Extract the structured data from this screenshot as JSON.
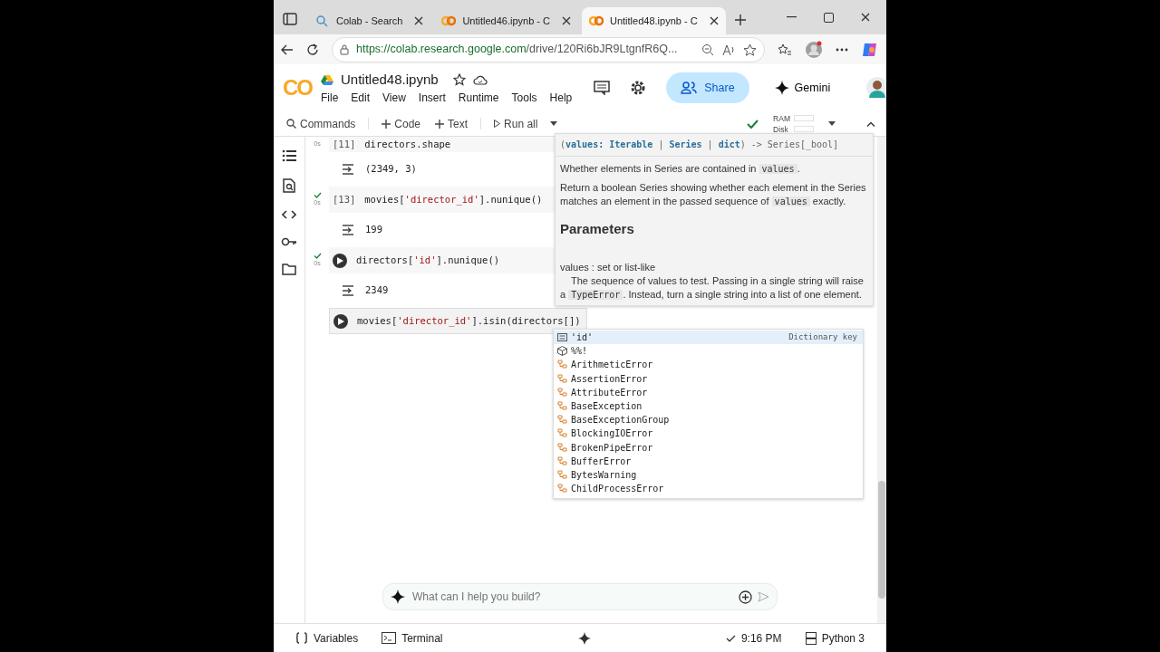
{
  "browser": {
    "tabs": [
      {
        "title": "Colab - Search",
        "selected": false
      },
      {
        "title": "Untitled46.ipynb - C",
        "selected": false
      },
      {
        "title": "Untitled48.ipynb - C",
        "selected": true
      }
    ],
    "url_host": "https://colab.research.google.com",
    "url_path": "/drive/120Ri6bJR9LtgnfR6Q..."
  },
  "notebook": {
    "title": "Untitled48.ipynb",
    "logo": "CO",
    "menu": [
      "File",
      "Edit",
      "View",
      "Insert",
      "Runtime",
      "Tools",
      "Help"
    ],
    "share": "Share",
    "gemini": "Gemini"
  },
  "toolbar": {
    "commands": "Commands",
    "code": "Code",
    "text": "Text",
    "run_all": "Run all",
    "ram": "RAM",
    "disk": "Disk",
    "connected": true
  },
  "cells": [
    {
      "prompt": "[11]",
      "code": "directors.shape",
      "time": "0s",
      "done": false,
      "run_button": false,
      "active": false,
      "output": "(2349, 3)"
    },
    {
      "prompt": "[13]",
      "code": "movies['director_id'].nunique()",
      "time": "0s",
      "done": true,
      "run_button": false,
      "active": false,
      "output": "199"
    },
    {
      "code": "directors['id'].nunique()",
      "time": "0s",
      "done": true,
      "run_button": true,
      "active": false,
      "output": "2349"
    },
    {
      "code": "movies['director_id'].isin(directors[])",
      "done": false,
      "run_button": true,
      "active": true
    }
  ],
  "tooltip": {
    "signature": [
      {
        "text": "(",
        "kind": "punct"
      },
      {
        "text": "values",
        "kind": "kw"
      },
      {
        "text": ": ",
        "kind": "kw"
      },
      {
        "text": "Iterable",
        "kind": "kw"
      },
      {
        "text": " | ",
        "kind": "punct"
      },
      {
        "text": "Series",
        "kind": "kw"
      },
      {
        "text": " | ",
        "kind": "punct"
      },
      {
        "text": "dict",
        "kind": "kw"
      },
      {
        "text": ") -> Series[_bool]",
        "kind": "punct"
      }
    ],
    "paragraphs": [
      [
        {
          "text": "Whether elements in Series are contained in ",
          "kind": "text"
        },
        {
          "text": "values",
          "kind": "code"
        },
        {
          "text": ".",
          "kind": "text"
        }
      ],
      [
        {
          "text": "Return a boolean Series showing whether each element in the Series matches an element in the passed sequence of ",
          "kind": "text"
        },
        {
          "text": "values",
          "kind": "code"
        },
        {
          "text": " exactly.",
          "kind": "text"
        }
      ]
    ],
    "heading": "Parameters",
    "param": "values : set or list-like",
    "param_desc": [
      {
        "text": "The sequence of values to test. Passing in a single string will raise a ",
        "kind": "text"
      },
      {
        "text": "TypeError",
        "kind": "code"
      },
      {
        "text": ". Instead, turn a single string into a list of one element.",
        "kind": "text"
      }
    ]
  },
  "completions": [
    {
      "label": "'id'",
      "kind": "key",
      "detail": "Dictionary key",
      "selected": true
    },
    {
      "label": "%%!",
      "kind": "snippet",
      "selected": false
    },
    {
      "label": "ArithmeticError",
      "kind": "class",
      "selected": false
    },
    {
      "label": "AssertionError",
      "kind": "class",
      "selected": false
    },
    {
      "label": "AttributeError",
      "kind": "class",
      "selected": false
    },
    {
      "label": "BaseException",
      "kind": "class",
      "selected": false
    },
    {
      "label": "BaseExceptionGroup",
      "kind": "class",
      "selected": false
    },
    {
      "label": "BlockingIOError",
      "kind": "class",
      "selected": false
    },
    {
      "label": "BrokenPipeError",
      "kind": "class",
      "selected": false
    },
    {
      "label": "BufferError",
      "kind": "class",
      "selected": false
    },
    {
      "label": "BytesWarning",
      "kind": "class",
      "selected": false
    },
    {
      "label": "ChildProcessError",
      "kind": "class",
      "selected": false
    }
  ],
  "gemini_box": {
    "placeholder": "What can I help you build?"
  },
  "status_bar": {
    "variables": "Variables",
    "terminal": "Terminal",
    "time": "9:16 PM",
    "runtime": "Python 3"
  }
}
